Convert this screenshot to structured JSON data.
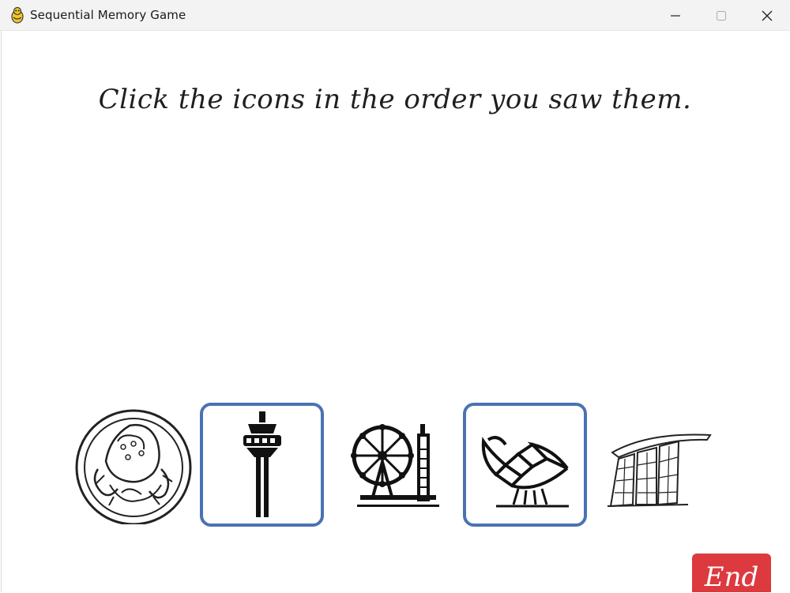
{
  "window": {
    "title": "Sequential Memory Game",
    "icon": "pygame-snake-icon",
    "controls": [
      "minimize-icon",
      "maximize-icon",
      "close-icon"
    ]
  },
  "game": {
    "instruction": "Click the icons in the order you saw them.",
    "tiles": [
      {
        "icon": "chilli-crab-plate-icon",
        "selected": false
      },
      {
        "icon": "control-tower-icon",
        "selected": true
      },
      {
        "icon": "ferris-wheel-icon",
        "selected": false
      },
      {
        "icon": "lotus-museum-icon",
        "selected": true
      },
      {
        "icon": "marina-bay-sands-icon",
        "selected": false
      }
    ],
    "selection_color": "#4a72b3"
  },
  "end_button": {
    "label": "End",
    "color": "#dc3a3e"
  }
}
